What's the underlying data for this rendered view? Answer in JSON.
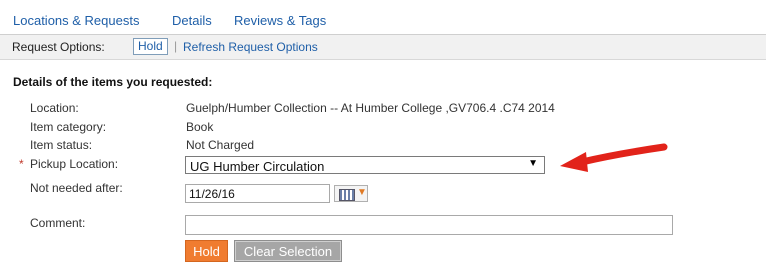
{
  "tabs": [
    {
      "label": "Locations & Requests"
    },
    {
      "label": "Details"
    },
    {
      "label": "Reviews & Tags"
    }
  ],
  "request_options": {
    "label": "Request Options:",
    "hold_link": "Hold",
    "separator": "|",
    "refresh_link": "Refresh Request Options"
  },
  "details": {
    "heading": "Details of the items you requested:",
    "location_label": "Location:",
    "location_value": "Guelph/Humber Collection -- At Humber College ,GV706.4 .C74 2014",
    "category_label": "Item category:",
    "category_value": "Book",
    "status_label": "Item status:",
    "status_value": "Not Charged"
  },
  "form": {
    "required_mark": "*",
    "pickup_label": "Pickup Location:",
    "pickup_value": "UG Humber Circulation",
    "not_needed_label": "Not needed after:",
    "not_needed_value": "11/26/16",
    "comment_label": "Comment:",
    "comment_value": "",
    "hold_button": "Hold",
    "clear_button": "Clear Selection"
  },
  "icons": {
    "dropdown": "chevron-down-icon",
    "calendar": "calendar-icon",
    "annotation": "red-arrow-icon"
  },
  "colors": {
    "link": "#1f5fa8",
    "hold_button": "#f07c30",
    "clear_button": "#a6a6a6",
    "required": "#c0392b",
    "annotation_arrow": "#e2231a"
  }
}
